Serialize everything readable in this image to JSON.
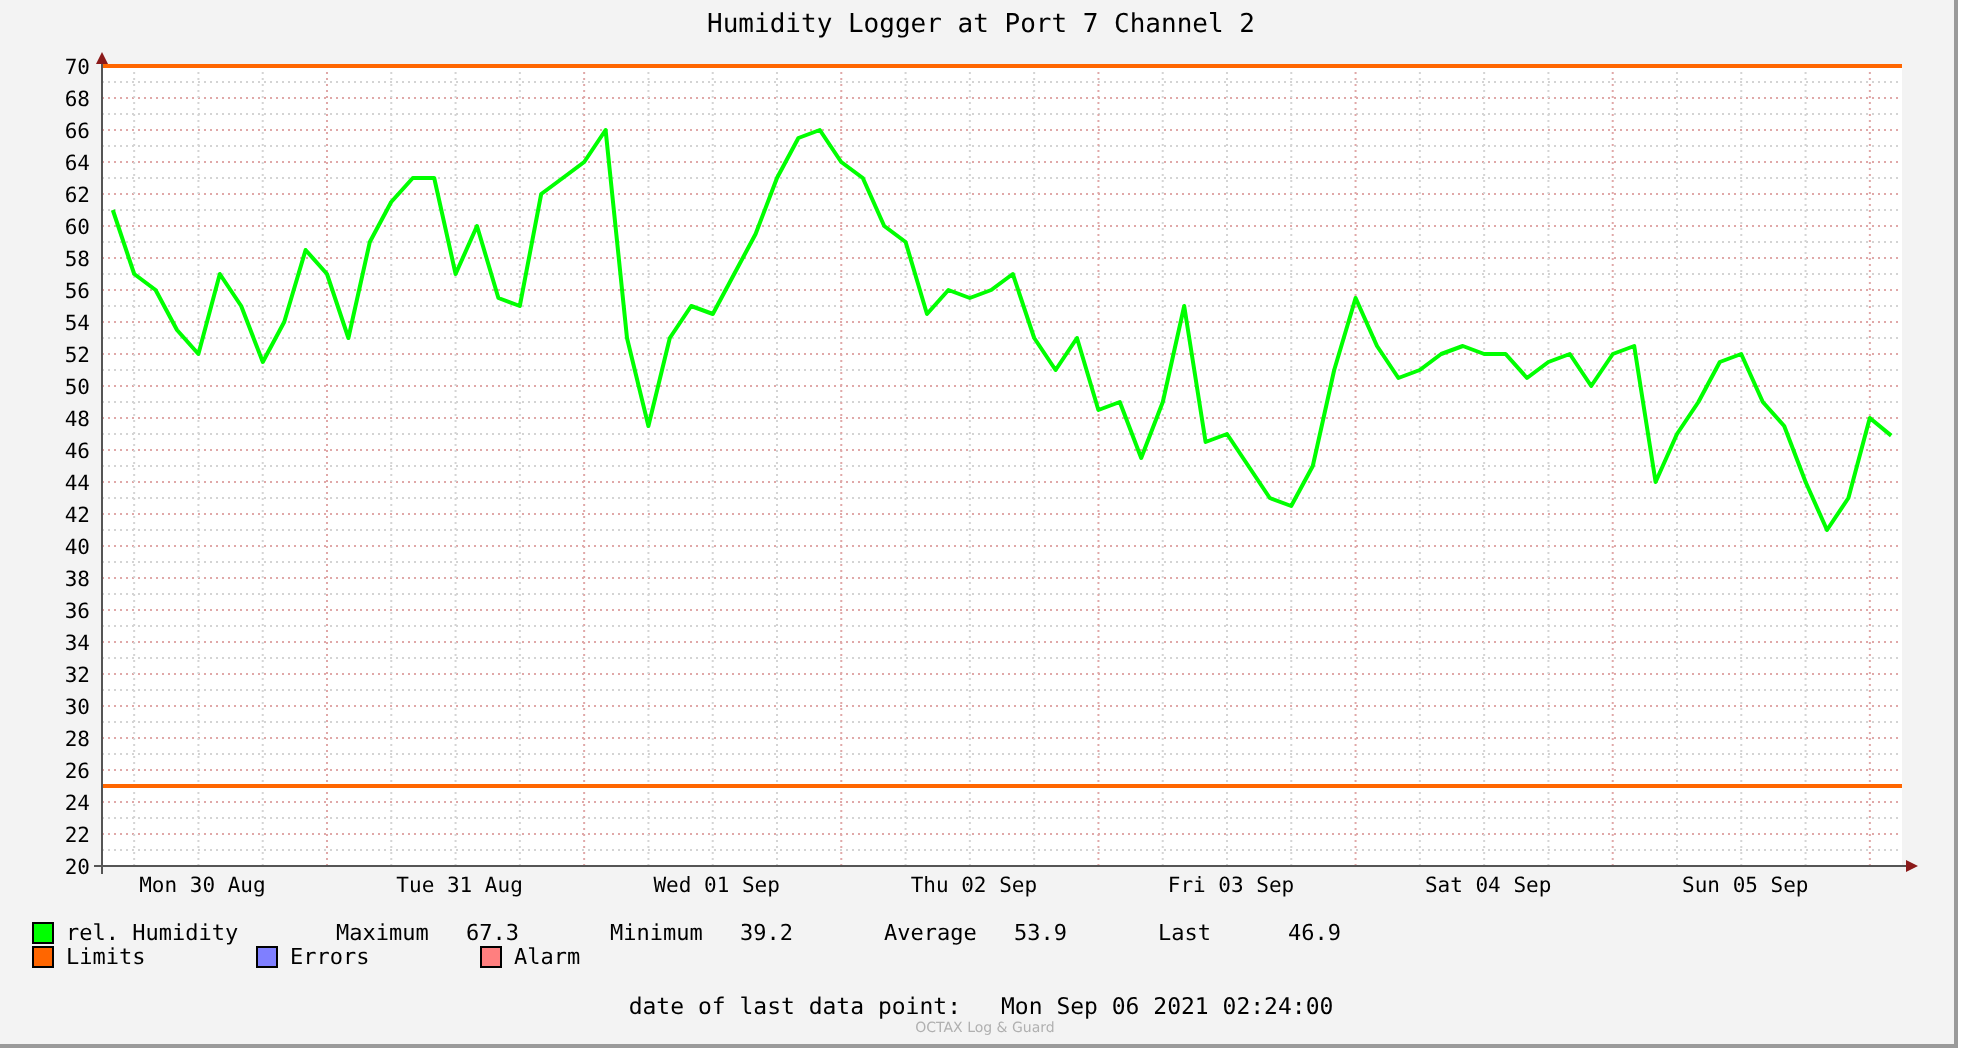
{
  "title": "Humidity Logger at Port 7 Channel 2",
  "chart_data": {
    "type": "line",
    "categories": [
      null,
      null,
      null,
      null,
      "Mon 30 Aug",
      null,
      null,
      null,
      null,
      null,
      null,
      null,
      null,
      null,
      null,
      null,
      "Tue 31 Aug",
      null,
      null,
      null,
      null,
      null,
      null,
      null,
      null,
      null,
      null,
      null,
      "Wed 01 Sep",
      null,
      null,
      null,
      null,
      null,
      null,
      null,
      null,
      null,
      null,
      null,
      "Thu 02 Sep",
      null,
      null,
      null,
      null,
      null,
      null,
      null,
      null,
      null,
      null,
      null,
      "Fri 03 Sep",
      null,
      null,
      null,
      null,
      null,
      null,
      null,
      null,
      null,
      null,
      null,
      "Sat 04 Sep",
      null,
      null,
      null,
      null,
      null,
      null,
      null,
      null,
      null,
      null,
      null,
      "Sun 05 Sep",
      null,
      null,
      null,
      null,
      null,
      null,
      null
    ],
    "series": [
      {
        "name": "rel. Humidity",
        "color": "#00ff00",
        "values": [
          61,
          57,
          56,
          53.5,
          52,
          57,
          55,
          51.5,
          54,
          58.5,
          57,
          53,
          59,
          61.5,
          63,
          63,
          57,
          60,
          55.5,
          55,
          62,
          63,
          64,
          66,
          53,
          47.5,
          53,
          55,
          54.5,
          57,
          59.5,
          63,
          65.5,
          66,
          64,
          63,
          60,
          59,
          54.5,
          56,
          55.5,
          56,
          57,
          53,
          51,
          53,
          48.5,
          49,
          45.5,
          49,
          55,
          46.5,
          47,
          45,
          43,
          42.5,
          45,
          51,
          55.5,
          52.5,
          50.5,
          51,
          52,
          52.5,
          52,
          52,
          50.5,
          51.5,
          52,
          50,
          52,
          52.5,
          44,
          47,
          49,
          51.5,
          52,
          49,
          47.5,
          44,
          41,
          43,
          48,
          46.9
        ]
      }
    ],
    "ylim": [
      20,
      70
    ],
    "yticks": [
      20,
      22,
      24,
      26,
      28,
      30,
      32,
      34,
      36,
      38,
      40,
      42,
      44,
      46,
      48,
      50,
      52,
      54,
      56,
      58,
      60,
      62,
      64,
      66,
      68,
      70
    ],
    "grid": true,
    "ref_lines": [
      {
        "axis": "y",
        "value": 70,
        "color": "#ff6600"
      },
      {
        "axis": "y",
        "value": 25,
        "color": "#ff6600"
      }
    ]
  },
  "legend": [
    {
      "stats": [
        {
          "label": "Maximum",
          "value": "67.3"
        },
        {
          "label": "Minimum",
          "value": "39.2"
        },
        {
          "label": "Average",
          "value": "53.9"
        },
        {
          "label": "Last",
          "value": "46.9"
        }
      ]
    },
    {
      "label": "Limits",
      "color": "#ff6600"
    },
    {
      "label": "Errors",
      "color": "#7f7fff"
    },
    {
      "label": "Alarm",
      "color": "#ff7f7f"
    }
  ],
  "footer": {
    "label": "date of last data point:",
    "value": "Mon Sep 06 2021 02:24:00"
  },
  "watermark": "OCTAX Log & Guard"
}
